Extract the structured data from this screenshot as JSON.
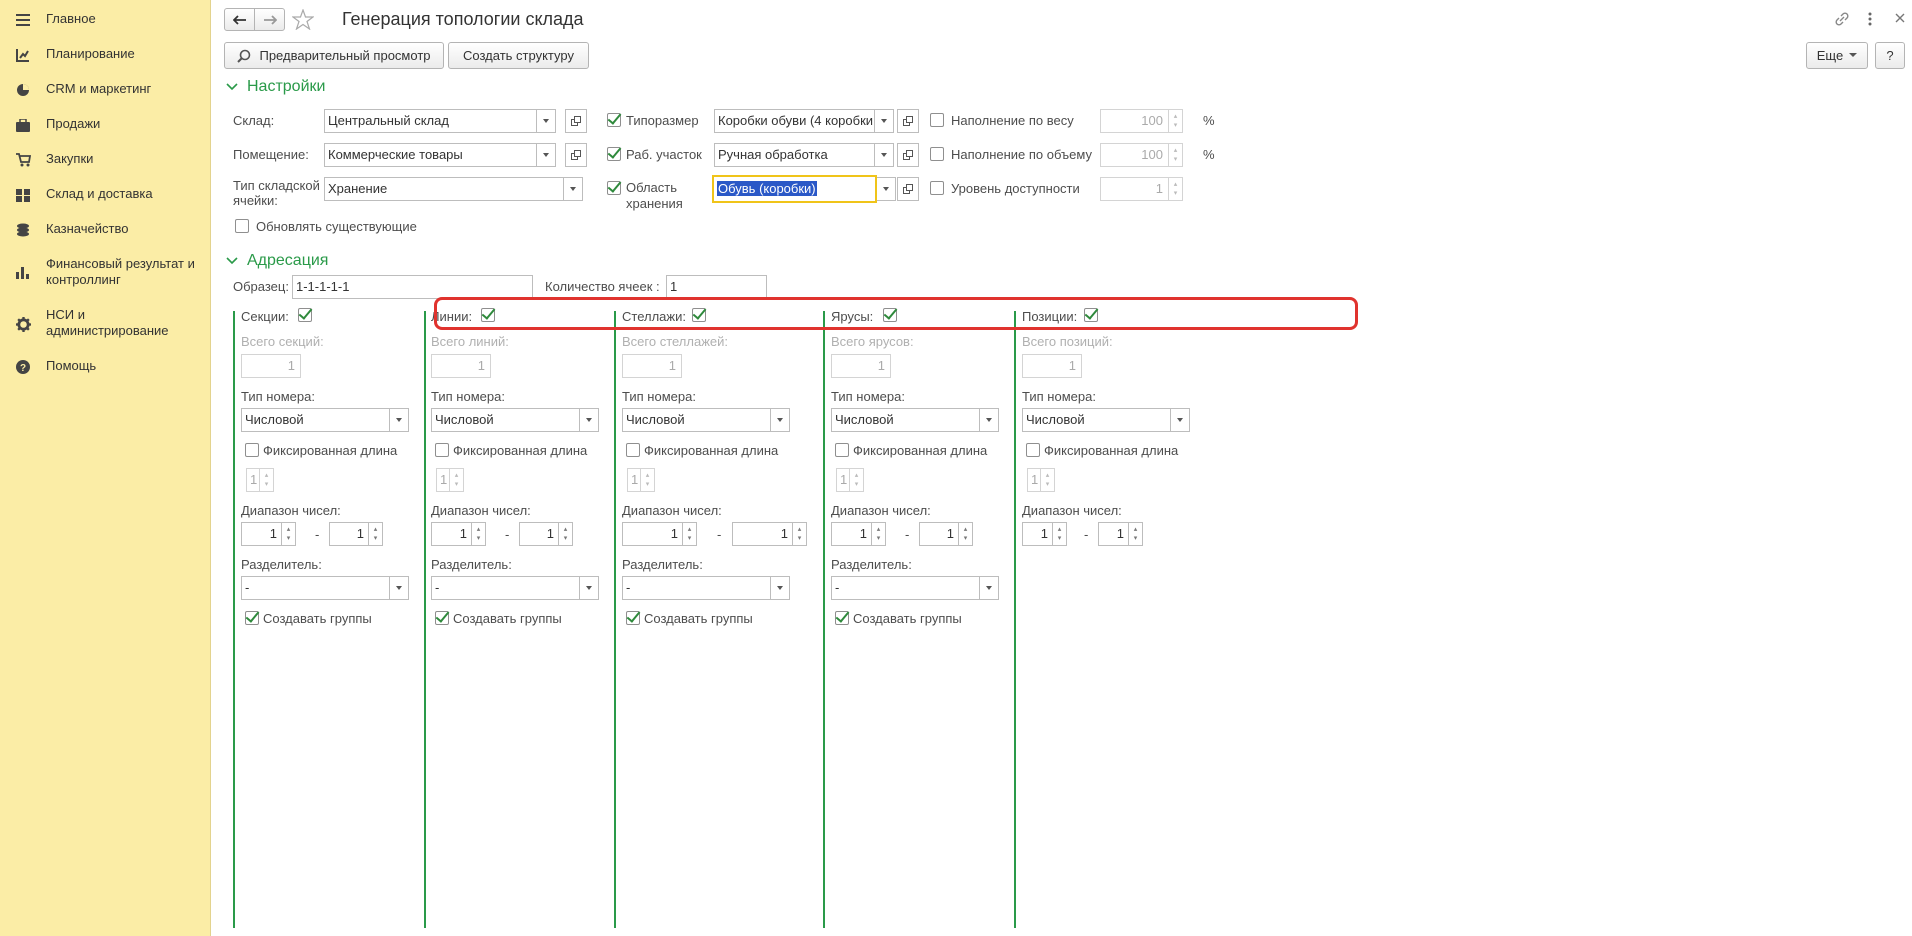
{
  "sidebar": {
    "items": [
      {
        "label": "Главное",
        "icon": "hamburger-icon"
      },
      {
        "label": "Планирование",
        "icon": "planning-chart-icon"
      },
      {
        "label": "CRM и маркетинг",
        "icon": "pie-chart-icon"
      },
      {
        "label": "Продажи",
        "icon": "briefcase-icon"
      },
      {
        "label": "Закупки",
        "icon": "cart-icon"
      },
      {
        "label": "Склад и доставка",
        "icon": "grid-icon"
      },
      {
        "label": "Казначейство",
        "icon": "coins-icon"
      },
      {
        "label": "Финансовый результат и контроллинг",
        "icon": "bar-chart-icon"
      },
      {
        "label": "НСИ и администрирование",
        "icon": "gear-icon"
      },
      {
        "label": "Помощь",
        "icon": "help-icon"
      }
    ]
  },
  "header": {
    "title": "Генерация топологии склада",
    "more_label": "Еще",
    "help_label": "?"
  },
  "toolbar": {
    "preview_label": "Предварительный просмотр",
    "create_label": "Создать структуру"
  },
  "settings": {
    "title": "Настройки",
    "warehouse_label": "Склад:",
    "warehouse_value": "Центральный склад",
    "room_label": "Помещение:",
    "room_value": "Коммерческие товары",
    "cell_type_label": "Тип складской ячейки:",
    "cell_type_value": "Хранение",
    "update_existing_label": "Обновлять существующие",
    "size_label": "Типоразмер",
    "size_value": "Коробки обуви (4 коробки",
    "work_area_label": "Раб. участок",
    "work_area_value": "Ручная обработка",
    "storage_area_label": "Область хранения",
    "storage_area_value": "Обувь (коробки)",
    "fill_weight_label": "Наполнение по весу",
    "fill_weight_value": "100",
    "fill_volume_label": "Наполнение по объему",
    "fill_volume_value": "100",
    "access_level_label": "Уровень доступности",
    "access_level_value": "1",
    "percent_sign": "%"
  },
  "addressing": {
    "title": "Адресация",
    "sample_label": "Образец:",
    "sample_value": "1-1-1-1-1",
    "count_label": "Количество ячеек :",
    "count_value": "1",
    "columns": [
      {
        "name": "Секции:",
        "total_label": "Всего секций:"
      },
      {
        "name": "Линии:",
        "total_label": "Всего линий:"
      },
      {
        "name": "Стеллажи:",
        "total_label": "Всего стеллажей:"
      },
      {
        "name": "Ярусы:",
        "total_label": "Всего ярусов:"
      },
      {
        "name": "Позиции:",
        "total_label": "Всего позиций:"
      }
    ],
    "total_value": "1",
    "number_type_label": "Тип номера:",
    "number_type_value": "Числовой",
    "fixed_length_label": "Фиксированная длина",
    "fixed_length_value": "1",
    "range_label": "Диапазон чисел:",
    "range_from": "1",
    "range_to": "1",
    "range_dash": "-",
    "separator_label": "Разделитель:",
    "separator_value": "-",
    "create_groups_label": "Создавать группы"
  }
}
